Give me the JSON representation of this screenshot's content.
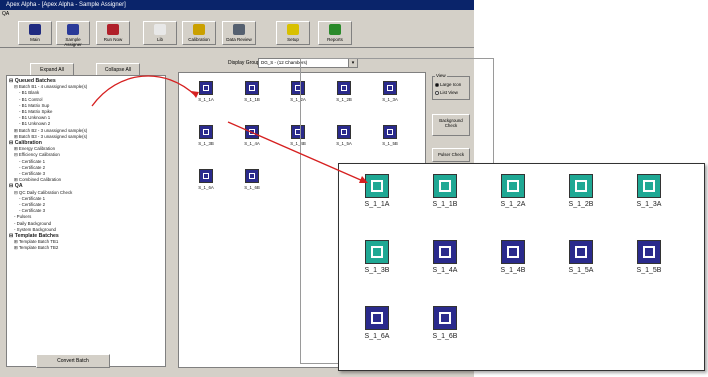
{
  "window": {
    "title": "Apex Alpha - [Apex Alpha - Sample Assigner]",
    "menu": "QA"
  },
  "toolbar": [
    {
      "label": "Main",
      "icon": "grid-icon",
      "color": "#1f2a80"
    },
    {
      "label": "Sample Assigner",
      "icon": "assigner-icon",
      "color": "#2a3a99"
    },
    {
      "label": "Run Now",
      "icon": "run-icon",
      "color": "#b0202a"
    },
    {
      "label": "Lib",
      "icon": "library-icon",
      "color": "#e8e8e8"
    },
    {
      "label": "Calibration",
      "icon": "calibration-icon",
      "color": "#caa000"
    },
    {
      "label": "Data Review",
      "icon": "binoculars-icon",
      "color": "#556070"
    },
    {
      "label": "Setup",
      "icon": "setup-icon",
      "color": "#d8c000"
    },
    {
      "label": "Reports",
      "icon": "reports-icon",
      "color": "#2a8a2a"
    }
  ],
  "left": {
    "expand_all": "Expand All",
    "collapse_all": "Collapse All",
    "convert_batch": "Convert Batch",
    "tree": [
      {
        "text": "⊟ Queued Batches",
        "bold": true,
        "indent": 0
      },
      {
        "text": "⊟ Batch B1 - 4 unassigned sample(s)",
        "bold": false,
        "indent": 1
      },
      {
        "text": "- B1 Blank",
        "bold": false,
        "indent": 2
      },
      {
        "text": "- B1 Control",
        "bold": false,
        "indent": 2
      },
      {
        "text": "- B1 Matrix Sup",
        "bold": false,
        "indent": 2
      },
      {
        "text": "- B1 Matrix Spike",
        "bold": false,
        "indent": 2
      },
      {
        "text": "- B1 Unknown 1",
        "bold": false,
        "indent": 2
      },
      {
        "text": "- B1 Unknown 2",
        "bold": false,
        "indent": 2
      },
      {
        "text": "⊞ Batch B2 - 3 unassigned sample(s)",
        "bold": false,
        "indent": 1
      },
      {
        "text": "⊞ Batch B3 - 3 unassigned sample(s)",
        "bold": false,
        "indent": 1
      },
      {
        "text": "⊟ Calibration",
        "bold": true,
        "indent": 0
      },
      {
        "text": "⊞ Energy Calibration",
        "bold": false,
        "indent": 1
      },
      {
        "text": "⊟ Efficiency Calibration",
        "bold": false,
        "indent": 1
      },
      {
        "text": "- Certificate 1",
        "bold": false,
        "indent": 2
      },
      {
        "text": "- Certificate 2",
        "bold": false,
        "indent": 2
      },
      {
        "text": "- Certificate 3",
        "bold": false,
        "indent": 2
      },
      {
        "text": "⊞ Combined Calibration",
        "bold": false,
        "indent": 1
      },
      {
        "text": "⊟ QA",
        "bold": true,
        "indent": 0
      },
      {
        "text": "⊟ QC Daily Calibration Check",
        "bold": false,
        "indent": 1
      },
      {
        "text": "- Certificate 1",
        "bold": false,
        "indent": 2
      },
      {
        "text": "- Certificate 2",
        "bold": false,
        "indent": 2
      },
      {
        "text": "- Certificate 3",
        "bold": false,
        "indent": 2
      },
      {
        "text": "- Pulsers",
        "bold": false,
        "indent": 1
      },
      {
        "text": "- Daily Background",
        "bold": false,
        "indent": 1
      },
      {
        "text": "- System Background",
        "bold": false,
        "indent": 1
      },
      {
        "text": "⊟ Template Batches",
        "bold": true,
        "indent": 0
      },
      {
        "text": "⊞ Template Batch TB1",
        "bold": false,
        "indent": 1
      },
      {
        "text": "⊞ Template Batch TB2",
        "bold": false,
        "indent": 1
      }
    ]
  },
  "main": {
    "display_group_label": "Display Group:",
    "display_group_value": "DG_S - (12 Chambers)",
    "view_label": "View",
    "view_options": [
      {
        "label": "Large Icon",
        "selected": true
      },
      {
        "label": "List View",
        "selected": false
      }
    ],
    "background_check": "Background Check",
    "pulser_check": "Pulser Check",
    "chambers": [
      "S_1_1A",
      "S_1_1B",
      "S_1_2A",
      "S_1_2B",
      "S_1_3A",
      "S_1_3B",
      "S_1_4A",
      "S_1_4B",
      "S_1_5A",
      "S_1_5B",
      "S_1_6A",
      "S_1_6B"
    ]
  },
  "zoom": {
    "chambers": [
      {
        "label": "S_1_1A",
        "state": "occupied"
      },
      {
        "label": "S_1_1B",
        "state": "occupied"
      },
      {
        "label": "S_1_2A",
        "state": "occupied"
      },
      {
        "label": "S_1_2B",
        "state": "occupied"
      },
      {
        "label": "S_1_3A",
        "state": "occupied"
      },
      {
        "label": "S_1_3B",
        "state": "occupied"
      },
      {
        "label": "S_1_4A",
        "state": "empty"
      },
      {
        "label": "S_1_4B",
        "state": "empty"
      },
      {
        "label": "S_1_5A",
        "state": "empty"
      },
      {
        "label": "S_1_5B",
        "state": "empty"
      },
      {
        "label": "S_1_6A",
        "state": "empty"
      },
      {
        "label": "S_1_6B",
        "state": "empty"
      }
    ]
  },
  "colors": {
    "chamber_navy": "#2a2a8c",
    "chamber_teal": "#1fa894",
    "arrow_red": "#d62020"
  }
}
